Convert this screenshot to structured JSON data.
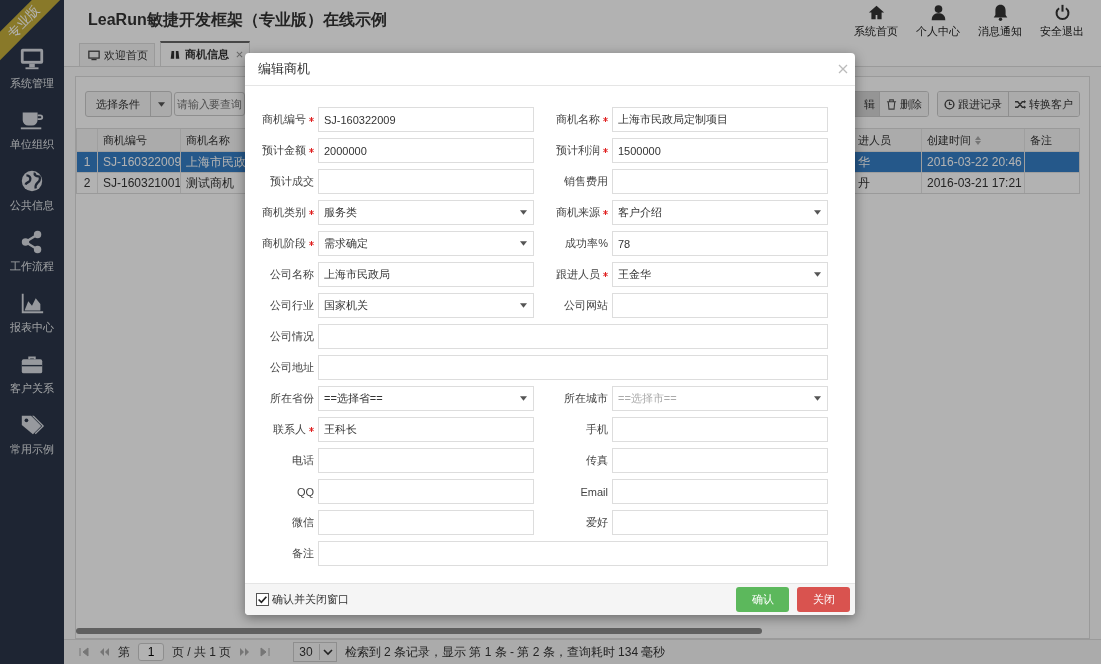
{
  "sidebar": {
    "badge": "专业版",
    "items": [
      {
        "label": "系统管理",
        "kind": "monitor"
      },
      {
        "label": "单位组织",
        "kind": "cup"
      },
      {
        "label": "公共信息",
        "kind": "globe"
      },
      {
        "label": "工作流程",
        "kind": "share"
      },
      {
        "label": "报表中心",
        "kind": "chart"
      },
      {
        "label": "客户关系",
        "kind": "briefcase"
      },
      {
        "label": "常用示例",
        "kind": "tag"
      }
    ]
  },
  "header": {
    "title": "LeaRun敏捷开发框架（专业版）在线示例",
    "actions": [
      {
        "label": "系统首页",
        "kind": "home"
      },
      {
        "label": "个人中心",
        "kind": "user"
      },
      {
        "label": "消息通知",
        "kind": "bell"
      },
      {
        "label": "安全退出",
        "kind": "power"
      }
    ]
  },
  "tabs": [
    {
      "label": "欢迎首页",
      "kind": "monitor",
      "selected": false,
      "closable": false
    },
    {
      "label": "商机信息",
      "kind": "binoculars",
      "selected": true,
      "closable": true
    }
  ],
  "toolbar": {
    "filter": "选择条件",
    "search": {
      "placeholder": "请输入要查询"
    },
    "button_groups": [
      [
        {
          "label": "辑",
          "kind": "none",
          "pressed": true
        },
        {
          "label": "删除",
          "kind": "trash",
          "pressed": false
        }
      ],
      [
        {
          "label": "跟进记录",
          "kind": "clock",
          "pressed": false
        },
        {
          "label": "转换客户",
          "kind": "shuffle",
          "pressed": false
        }
      ]
    ]
  },
  "table": {
    "columns": [
      {
        "label": "商机编号",
        "sortable": false
      },
      {
        "label": "商机名称",
        "sortable": false
      },
      {
        "label": "进人员",
        "sortable": false
      },
      {
        "label": "创建时间",
        "sortable": true
      },
      {
        "label": "备注",
        "sortable": false
      }
    ],
    "rows": [
      {
        "number": "1",
        "code": "SJ-160322009",
        "name": "上海市民政",
        "follower": "华",
        "created": "2016-03-22 20:46",
        "selected": true
      },
      {
        "number": "2",
        "code": "SJ-160321001",
        "name": "测试商机",
        "follower": "丹",
        "created": "2016-03-21 17:21",
        "selected": false
      }
    ]
  },
  "pager": {
    "prefix": "第",
    "page": "1",
    "suffix": "页 / 共 1 页",
    "page_size": "30",
    "summary": "检索到 2 条记录，显示 第 1 条 - 第 2 条，查询耗时 134 毫秒"
  },
  "dialog": {
    "title": "编辑商机",
    "fields": [
      {
        "label": "商机编号",
        "kind": "text",
        "required": true,
        "wide": false,
        "value": "SJ-160322009"
      },
      {
        "label": "商机名称",
        "kind": "text",
        "required": true,
        "wide": false,
        "value": "上海市民政局定制项目"
      },
      {
        "label": "预计金额",
        "kind": "text",
        "required": true,
        "wide": false,
        "value": "2000000"
      },
      {
        "label": "预计利润",
        "kind": "text",
        "required": true,
        "wide": false,
        "value": "1500000"
      },
      {
        "label": "预计成交",
        "kind": "text",
        "required": false,
        "wide": false
      },
      {
        "label": "销售费用",
        "kind": "text",
        "required": false,
        "wide": false
      },
      {
        "label": "商机类别",
        "kind": "select",
        "required": true,
        "wide": false,
        "value": "服务类"
      },
      {
        "label": "商机来源",
        "kind": "select",
        "required": true,
        "wide": false,
        "value": "客户介绍"
      },
      {
        "label": "商机阶段",
        "kind": "select",
        "required": true,
        "wide": false,
        "value": "需求确定"
      },
      {
        "label": "成功率%",
        "kind": "text",
        "required": false,
        "wide": false,
        "value": "78"
      },
      {
        "label": "公司名称",
        "kind": "text",
        "required": false,
        "wide": false,
        "value": "上海市民政局"
      },
      {
        "label": "跟进人员",
        "kind": "select",
        "required": true,
        "wide": false,
        "value": "王金华"
      },
      {
        "label": "公司行业",
        "kind": "select",
        "required": false,
        "wide": false,
        "value": "国家机关"
      },
      {
        "label": "公司网站",
        "kind": "text",
        "required": false,
        "wide": false
      },
      {
        "label": "公司情况",
        "kind": "text",
        "required": false,
        "wide": true
      },
      {
        "label": "公司地址",
        "kind": "text",
        "required": false,
        "wide": true
      },
      {
        "label": "所在省份",
        "kind": "select",
        "required": false,
        "wide": false,
        "value": "==选择省=="
      },
      {
        "label": "所在城市",
        "kind": "select",
        "required": false,
        "wide": false,
        "placeholder": "==选择市=="
      },
      {
        "label": "联系人",
        "kind": "text",
        "required": true,
        "wide": false,
        "value": "王科长"
      },
      {
        "label": "手机",
        "kind": "text",
        "required": false,
        "wide": false
      },
      {
        "label": "电话",
        "kind": "text",
        "required": false,
        "wide": false
      },
      {
        "label": "传真",
        "kind": "text",
        "required": false,
        "wide": false
      },
      {
        "label": "QQ",
        "kind": "text",
        "required": false,
        "wide": false
      },
      {
        "label": "Email",
        "kind": "text",
        "required": false,
        "wide": false
      },
      {
        "label": "微信",
        "kind": "text",
        "required": false,
        "wide": false
      },
      {
        "label": "爱好",
        "kind": "text",
        "required": false,
        "wide": false
      },
      {
        "label": "备注",
        "kind": "text",
        "required": false,
        "wide": true
      }
    ],
    "confirm_close": {
      "label": "确认并关闭窗口",
      "checked": true
    },
    "buttons": [
      {
        "label": "确认",
        "kind": "confirm"
      },
      {
        "label": "关闭",
        "kind": "close"
      }
    ]
  }
}
